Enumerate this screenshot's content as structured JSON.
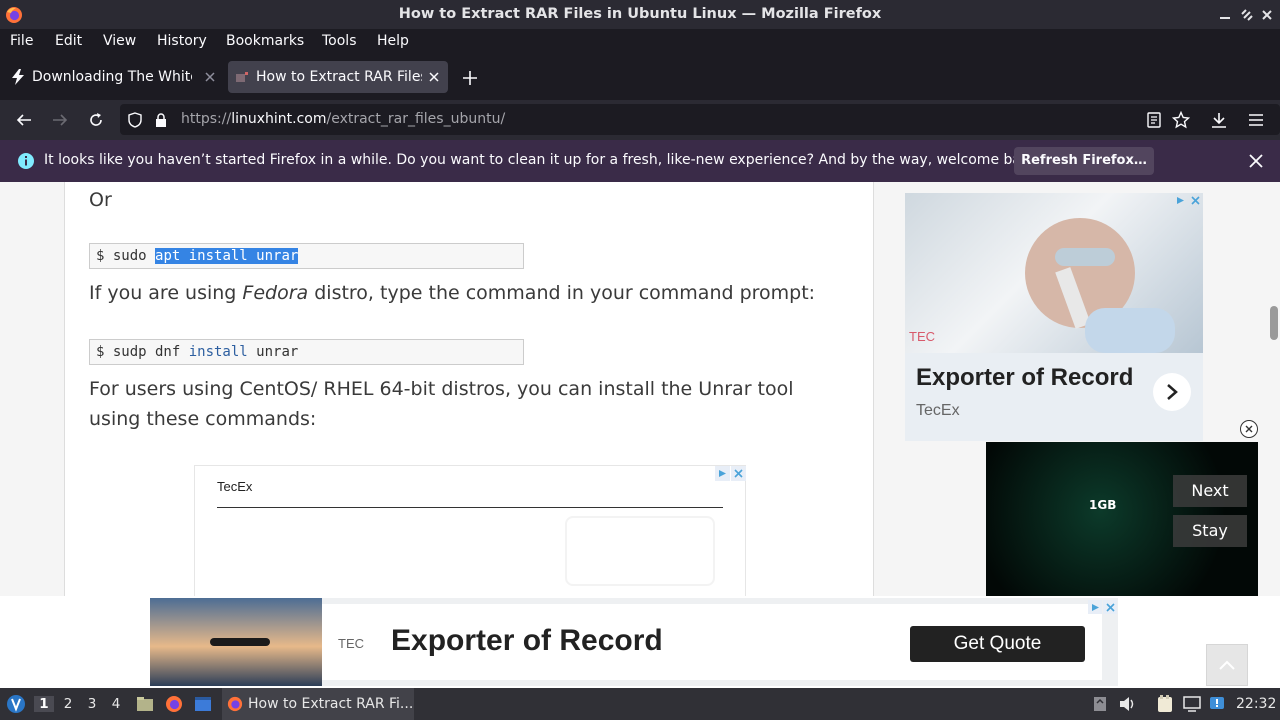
{
  "window": {
    "title": "How to Extract RAR Files in Ubuntu Linux — Mozilla Firefox"
  },
  "menu": [
    "File",
    "Edit",
    "View",
    "History",
    "Bookmarks",
    "Tools",
    "Help"
  ],
  "tabs": [
    {
      "label": "Downloading The White Ho"
    },
    {
      "label": "How to Extract RAR Files"
    }
  ],
  "url": {
    "prefix": "https://",
    "domain": "linuxhint.com",
    "path": "/extract_rar_files_ubuntu/"
  },
  "notification": {
    "message": "It looks like you haven’t started Firefox in a while. Do you want to clean it up for a fresh, like-new experience? And by the way, welcome back!",
    "button": "Refresh Firefox…"
  },
  "article": {
    "or": "Or",
    "cmd1_prompt": "$ sudo ",
    "cmd1_selected": "apt install unrar",
    "fedora_pre": "If you are using ",
    "fedora_em": "Fedora",
    "fedora_post": " distro, type the command in your command prompt:",
    "cmd2_a": "$ sudp dnf ",
    "cmd2_kw": "install",
    "cmd2_b": " unrar",
    "centos": "For users using CentOS/ RHEL 64-bit distros, you can install the Unrar tool using these commands:"
  },
  "inline_ad": {
    "advertiser": "TecEx"
  },
  "side_ad": {
    "brand": "TEC",
    "headline": "Exporter of Record",
    "advertiser": "TecEx"
  },
  "video_ad": {
    "text": "1GB",
    "next": "Next",
    "stay": "Stay"
  },
  "bottom_ad": {
    "brand": "TEC",
    "headline": "Exporter of Record",
    "cta": "Get Quote"
  },
  "taskbar": {
    "workspaces": [
      "1",
      "2",
      "3",
      "4"
    ],
    "active_window": "How to Extract RAR Fi...",
    "clock": "22:32"
  },
  "colors": {
    "accent": "#3584e4",
    "notification_bg": "#3a2b48",
    "toolbar": "#2b2a33"
  }
}
